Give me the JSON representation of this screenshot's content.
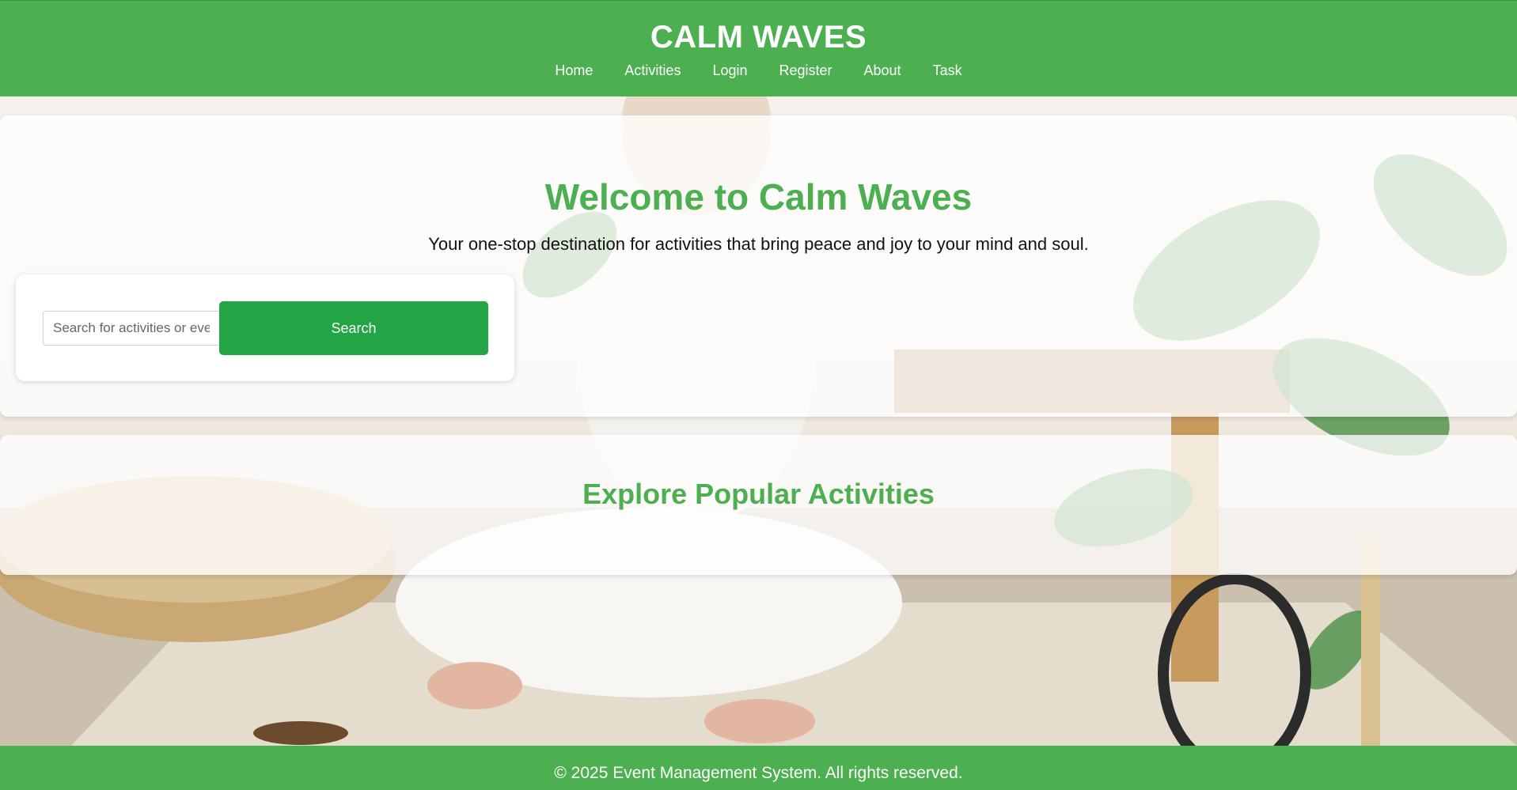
{
  "header": {
    "title": "CALM WAVES",
    "nav": [
      "Home",
      "Activities",
      "Login",
      "Register",
      "About",
      "Task"
    ]
  },
  "hero": {
    "title": "Welcome to Calm Waves",
    "subtitle": "Your one-stop destination for activities that bring peace and joy to your mind and soul."
  },
  "search": {
    "placeholder": "Search for activities or events",
    "button_label": "Search"
  },
  "explore": {
    "title": "Explore Popular Activities"
  },
  "footer": {
    "text": "© 2025 Event Management System. All rights reserved."
  },
  "colors": {
    "brand_green": "#4caf50",
    "button_green": "#23a445"
  }
}
